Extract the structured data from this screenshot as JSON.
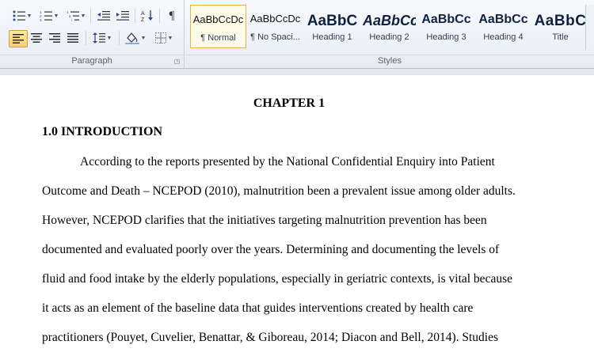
{
  "ribbon": {
    "paragraph_group": {
      "label": "Paragraph",
      "tools": [
        {
          "name": "bullets",
          "icon": "bullets-icon"
        },
        {
          "name": "numbering",
          "icon": "numbering-icon"
        },
        {
          "name": "multilevel-list",
          "icon": "multilevel-list-icon"
        },
        {
          "name": "decrease-indent",
          "icon": "decrease-indent-icon"
        },
        {
          "name": "increase-indent",
          "icon": "increase-indent-icon"
        },
        {
          "name": "sort",
          "icon": "sort-icon"
        },
        {
          "name": "show-marks",
          "icon": "pilcrow-icon"
        },
        {
          "name": "align-left",
          "icon": "align-left-icon",
          "active": true
        },
        {
          "name": "center",
          "icon": "align-center-icon"
        },
        {
          "name": "align-right",
          "icon": "align-right-icon"
        },
        {
          "name": "justify",
          "icon": "justify-icon"
        },
        {
          "name": "line-spacing",
          "icon": "line-spacing-icon"
        },
        {
          "name": "shading",
          "icon": "shading-icon"
        },
        {
          "name": "borders",
          "icon": "borders-icon"
        }
      ]
    },
    "styles_group": {
      "label": "Styles",
      "styles": [
        {
          "preview": "AaBbCcDc",
          "name": "¶ Normal",
          "selected": true
        },
        {
          "preview": "AaBbCcDc",
          "name": "¶ No Spaci..."
        },
        {
          "preview": "AaBbC",
          "name": "Heading 1"
        },
        {
          "preview": "AaBbCc",
          "name": "Heading 2"
        },
        {
          "preview": "AaBbCc",
          "name": "Heading 3"
        },
        {
          "preview": "AaBbCc",
          "name": "Heading 4"
        },
        {
          "preview": "AaBbC",
          "name": "Title"
        }
      ]
    }
  },
  "document": {
    "chapter": "CHAPTER 1",
    "heading": "1.0 INTRODUCTION",
    "lines": [
      "According to the reports presented by the National Confidential Enquiry into Patient",
      "Outcome and Death – NCEPOD (2010), malnutrition been a prevalent issue among older adults.",
      "However, NCEPOD clarifies that the initiatives targeting malnutrition prevention has been",
      "documented and evaluated poorly over the years. Determining and documenting the levels  of",
      "fluid and food intake by the elderly populations, especially in geriatric contexts, is vital because",
      "it acts as an element of the baseline data that guides interventions created by health care",
      "practitioners (Pouyet, Cuvelier, Benattar, & Giboreau, 2014; Diacon and Bell, 2014). Studies"
    ]
  },
  "colors": {
    "ribbon_bg": "#eef2f8",
    "active_tool": "#f8d06a",
    "selected_style_border": "#e2b44a",
    "heading_text": "#10213e"
  }
}
